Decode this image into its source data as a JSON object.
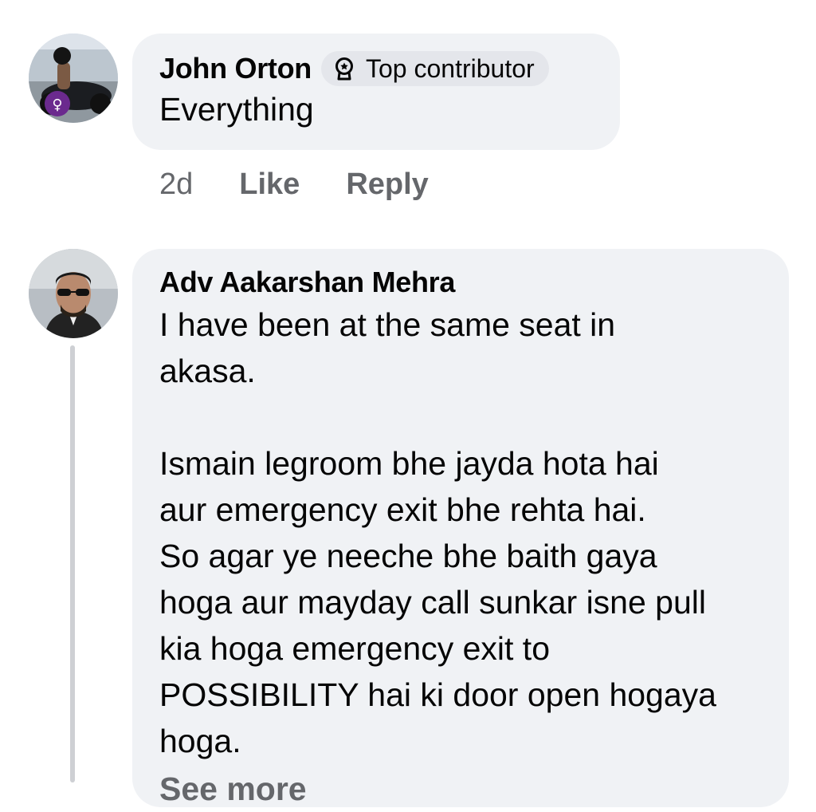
{
  "comments": [
    {
      "author": "John Orton",
      "badge": {
        "label": "Top contributor",
        "icon": "top-contributor-icon"
      },
      "text": "Everything",
      "time": "2d",
      "like_label": "Like",
      "reply_label": "Reply"
    },
    {
      "author": "Adv Aakarshan Mehra",
      "text": "I have been at the same seat in\nakasa.\n\nIsmain legroom bhe jayda hota hai\naur emergency exit bhe rehta hai.\nSo agar ye neeche bhe baith gaya\nhoga aur mayday call sunkar isne pull\nkia hoga emergency exit to\nPOSSIBILITY hai ki door open hogaya\nhoga.",
      "see_more_label": "See more"
    }
  ],
  "colors": {
    "bubble": "#f0f2f5",
    "badge_bg": "#e4e6eb",
    "secondary_text": "#65676b",
    "thread_line": "#ced0d4"
  }
}
